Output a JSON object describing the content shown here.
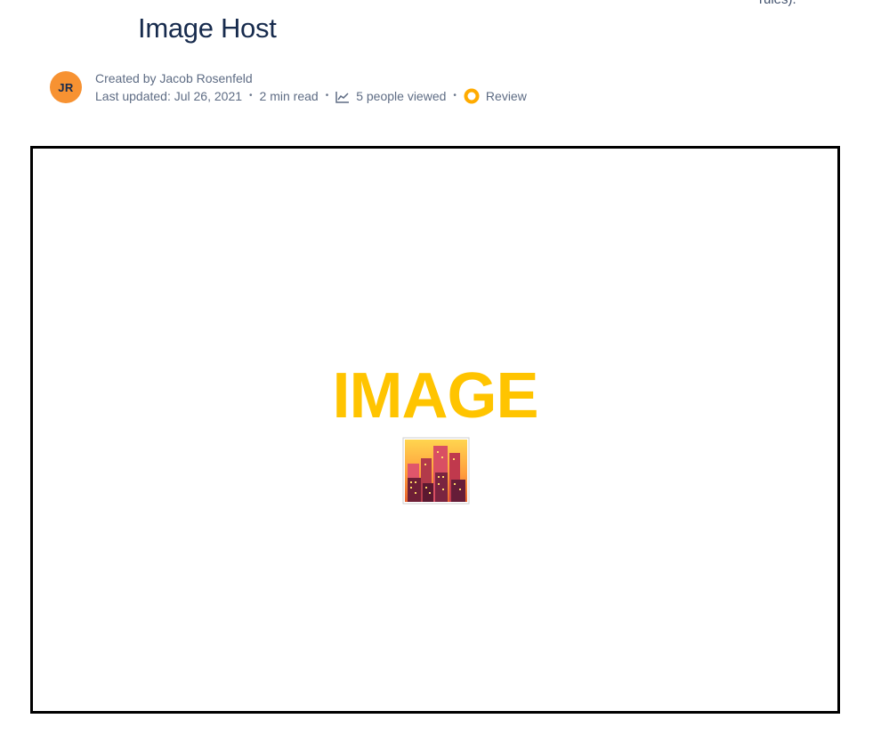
{
  "top_cut_text": "rules).",
  "page": {
    "title": "Image Host"
  },
  "byline": {
    "avatar_initials": "JR",
    "created_by": "Created by Jacob Rosenfeld",
    "last_updated": "Last updated: Jul 26, 2021",
    "read_time": "2 min read",
    "views": "5 people viewed",
    "status": "Review",
    "separator": "•"
  },
  "image": {
    "label": "IMAGE",
    "icon": "cityscape-at-dusk-icon"
  },
  "colors": {
    "title": "#172b4d",
    "meta_text": "#5e6c84",
    "avatar_bg": "#f79232",
    "status_ring": "#ffab00",
    "image_label": "#ffc400",
    "frame_border": "#000000"
  }
}
